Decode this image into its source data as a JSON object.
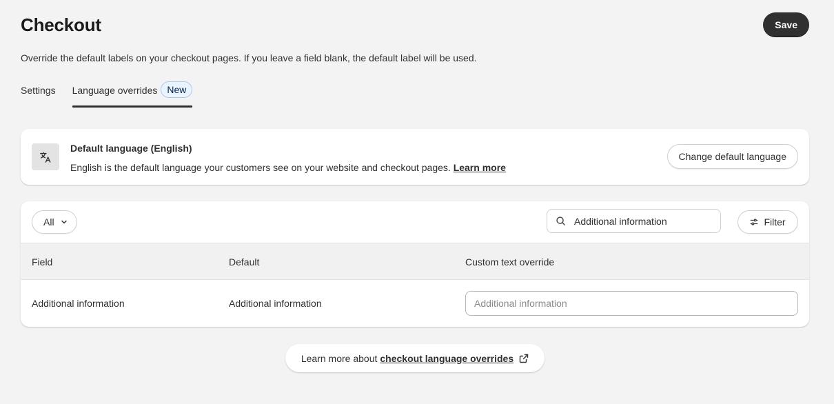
{
  "header": {
    "title": "Checkout",
    "save_label": "Save"
  },
  "description": "Override the default labels on your checkout pages. If you leave a field blank, the default label will be used.",
  "tabs": [
    {
      "label": "Settings",
      "active": false
    },
    {
      "label": "Language overrides",
      "active": true,
      "badge": "New"
    }
  ],
  "default_language": {
    "icon": "translate-icon",
    "title": "Default language (English)",
    "description": "English is the default language your customers see on your website and checkout pages.",
    "link_label": "Learn more",
    "button_label": "Change default language"
  },
  "toolbar": {
    "filter_select_value": "All",
    "search_value": "Additional information",
    "filter_label": "Filter"
  },
  "table": {
    "columns": [
      "Field",
      "Default",
      "Custom text override"
    ],
    "rows": [
      {
        "field": "Additional information",
        "default": "Additional information",
        "override_placeholder": "Additional information",
        "override_value": ""
      }
    ]
  },
  "footer": {
    "prefix": "Learn more about",
    "link_label": "checkout language overrides"
  },
  "colors": {
    "background": "#f3f3f3",
    "primary_button": "#303030",
    "badge_bg": "#eaf4ff"
  }
}
